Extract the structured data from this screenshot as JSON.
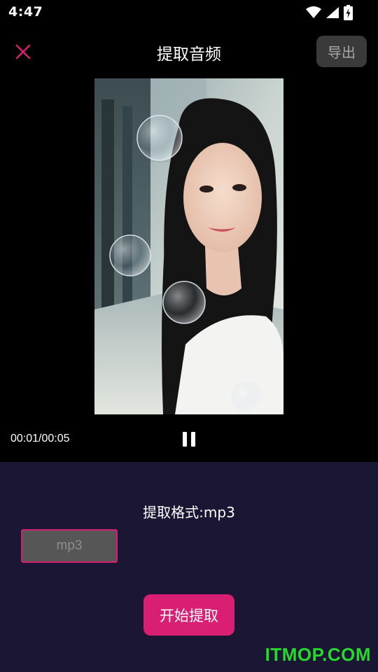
{
  "status_bar": {
    "time": "4:47",
    "icons": [
      "wifi-icon",
      "cell-signal-icon",
      "battery-charging-icon"
    ]
  },
  "header": {
    "close_icon": "close-icon",
    "title": "提取音频",
    "export_label": "导出"
  },
  "player": {
    "time_display": "00:01/00:05",
    "pause_icon": "pause-icon"
  },
  "extract": {
    "format_label": "提取格式:mp3",
    "format_value": "mp3",
    "start_label": "开始提取"
  },
  "watermark": "ITMOP.COM",
  "colors": {
    "accent": "#d81f73",
    "panel_bg": "#1b1634",
    "export_bg": "#3a3a3a",
    "watermark": "#27d82d"
  }
}
